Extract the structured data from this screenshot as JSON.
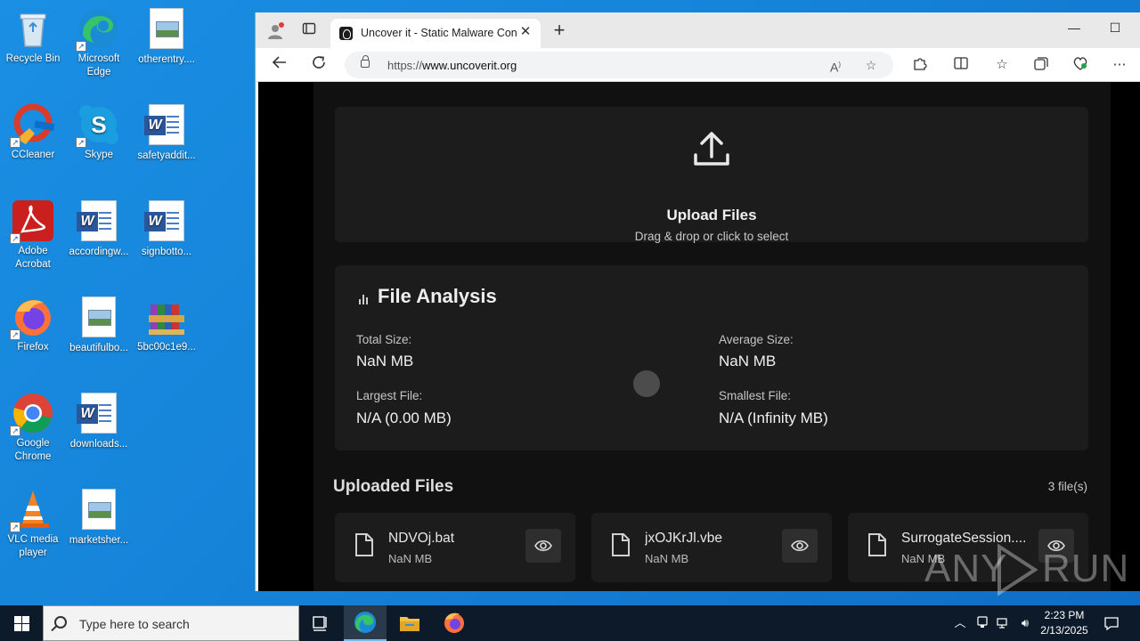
{
  "desktop": {
    "icons": [
      {
        "label": "Recycle Bin"
      },
      {
        "label": "Microsoft Edge"
      },
      {
        "label": "otherentry...."
      },
      {
        "label": "CCleaner"
      },
      {
        "label": "Skype"
      },
      {
        "label": "safetyaddit..."
      },
      {
        "label": "Adobe Acrobat"
      },
      {
        "label": "accordingw..."
      },
      {
        "label": "signbotto..."
      },
      {
        "label": "Firefox"
      },
      {
        "label": "beautifulbo..."
      },
      {
        "label": "5bc00c1e9..."
      },
      {
        "label": "Google Chrome"
      },
      {
        "label": "downloads..."
      },
      {
        "label": "VLC media player"
      },
      {
        "label": "marketsher..."
      }
    ]
  },
  "browser": {
    "tab_title": "Uncover it - Static Malware Confi",
    "url_prefix": "https://",
    "url_domain": "www.uncoverit.org"
  },
  "page": {
    "upload": {
      "title": "Upload Files",
      "hint": "Drag & drop or click to select"
    },
    "analysis": {
      "title": "File Analysis",
      "total_size_label": "Total Size:",
      "total_size_value": "NaN MB",
      "average_size_label": "Average Size:",
      "average_size_value": "NaN MB",
      "largest_file_label": "Largest File:",
      "largest_file_value": "N/A (0.00 MB)",
      "smallest_file_label": "Smallest File:",
      "smallest_file_value": "N/A (Infinity MB)"
    },
    "uploaded": {
      "title": "Uploaded Files",
      "count": "3 file(s)",
      "files": [
        {
          "name": "NDVOj.bat",
          "size": "NaN MB"
        },
        {
          "name": "jxOJKrJl.vbe",
          "size": "NaN MB"
        },
        {
          "name": "SurrogateSession....",
          "size": "NaN MB"
        }
      ]
    }
  },
  "watermark": {
    "left": "ANY",
    "right": "RUN"
  },
  "taskbar": {
    "search_placeholder": "Type here to search",
    "time": "2:23 PM",
    "date": "2/13/2025"
  }
}
